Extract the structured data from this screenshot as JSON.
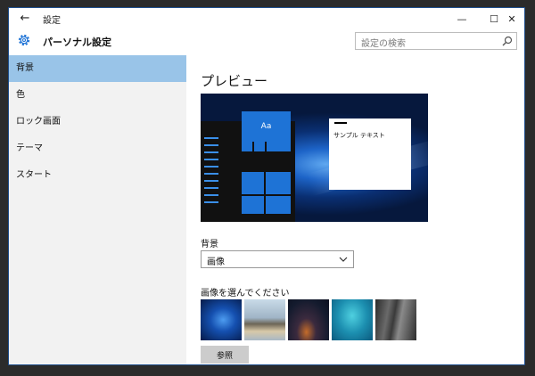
{
  "window": {
    "title": "設定"
  },
  "header": {
    "app_title": "パーソナル設定",
    "search_placeholder": "設定の検索"
  },
  "sidebar": {
    "items": [
      {
        "label": "背景",
        "active": true
      },
      {
        "label": "色",
        "active": false
      },
      {
        "label": "ロック画面",
        "active": false
      },
      {
        "label": "テーマ",
        "active": false
      },
      {
        "label": "スタート",
        "active": false
      }
    ]
  },
  "main": {
    "preview_title": "プレビュー",
    "preview": {
      "tile_label": "Aa",
      "sample_text": "サンプル テキスト"
    },
    "background_label": "背景",
    "background_value": "画像",
    "choose_image_label": "画像を選んでください",
    "browse_label": "参照"
  },
  "colors": {
    "accent": "#1e73d6",
    "selected_nav": "#99c4e8",
    "sidebar_bg": "#f2f2f2"
  }
}
